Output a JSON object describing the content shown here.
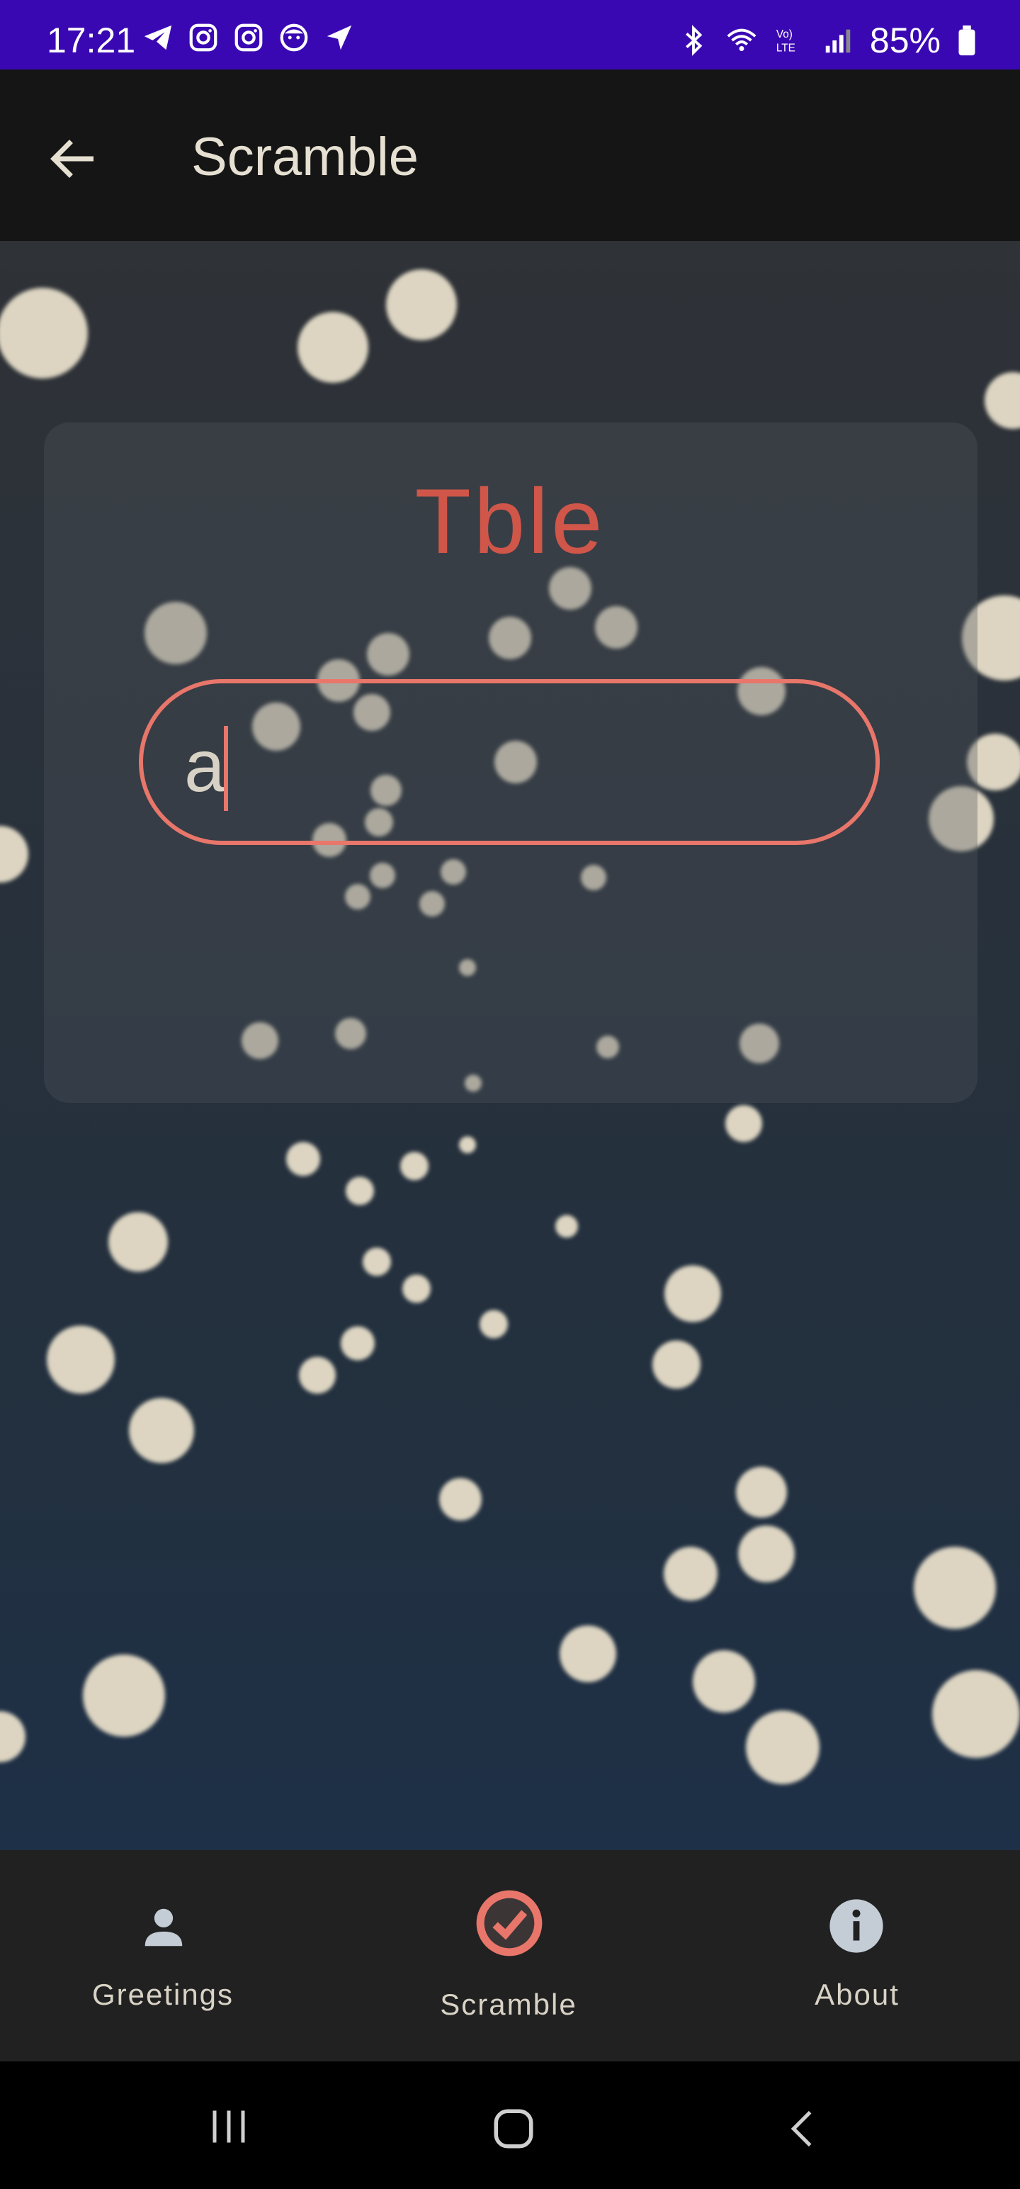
{
  "status_bar": {
    "time": "17:21",
    "battery": "85%",
    "left_icons": [
      "telegram-icon",
      "instagram-icon",
      "instagram-icon",
      "app-face-icon",
      "location-arrow-icon"
    ],
    "right_icons": [
      "bluetooth-icon",
      "wifi-icon",
      "volte-icon",
      "signal-icon",
      "battery-icon"
    ]
  },
  "app_bar": {
    "title": "Scramble"
  },
  "game": {
    "scrambled_word": "Tble",
    "answer_value": "a"
  },
  "bottom_nav": {
    "items": [
      {
        "label": "Greetings",
        "icon": "person-icon",
        "selected": false
      },
      {
        "label": "Scramble",
        "icon": "check-circle-icon",
        "selected": true
      },
      {
        "label": "About",
        "icon": "info-icon",
        "selected": false
      }
    ]
  },
  "colors": {
    "status_bar": "#3a08b3",
    "accent": "#e8766a",
    "word": "#d0564a",
    "nav_bg": "#212121"
  }
}
